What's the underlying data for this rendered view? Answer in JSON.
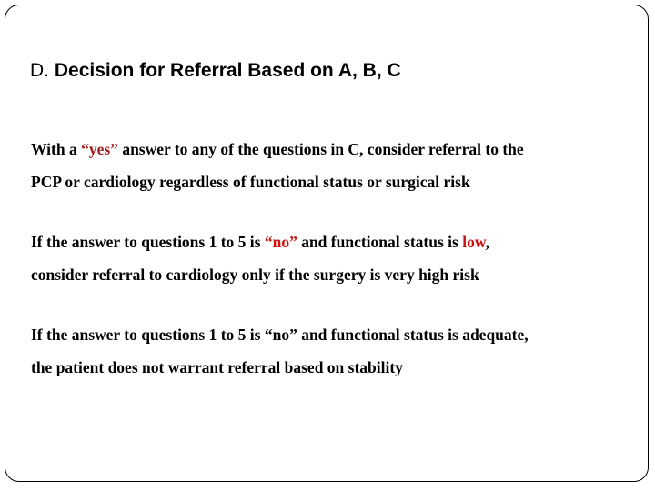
{
  "slide": {
    "title": {
      "prefix": "D.",
      "main": "Decision for Referral Based on A, B, C",
      "full": "D. Decision for Referral Based on A, B, C"
    },
    "paragraphs": [
      {
        "id": "paragraph-yes-referral",
        "segments": [
          {
            "text": "With a ",
            "color": "black"
          },
          {
            "text": "“yes”",
            "color": "#9e1b1b"
          },
          {
            "text": " answer to any of the questions in C, consider referral to the",
            "color": "black"
          }
        ],
        "line1": "With a “yes” answer to any of the questions in C, consider referral to the",
        "line2": "PCP or cardiology regardless of functional status or surgical risk",
        "full_text": "With a “yes” answer to any of the questions in C, consider referral to the PCP or cardiology regardless of functional status or surgical risk"
      },
      {
        "id": "paragraph-no-low-functional-status",
        "line1_a": "If the answer to questions 1 to 5 is ",
        "line1_no": "“no”",
        "line1_b": " and functional status is ",
        "line1_low": "low",
        "line1_c": ",",
        "line2": "consider referral to cardiology only if the surgery is very high risk",
        "full_text": "If the answer to questions 1 to 5 is “no” and functional status is low, consider referral to cardiology only if the surgery is very high risk"
      },
      {
        "id": "paragraph-no-adequate-functional-status",
        "line1": "If the answer to questions 1 to 5 is “no” and functional status is adequate,",
        "line2": "the patient does not warrant referral based on stability",
        "full_text": "If the answer to questions 1 to 5 is “no” and functional status is adequate, the patient does not warrant referral based on stability"
      }
    ]
  },
  "colors": {
    "background": "#ffffff",
    "text": "#000000",
    "border": "#000000",
    "accent_red_dark": "#9e1b1b",
    "accent_red_bright": "#cc1111"
  }
}
